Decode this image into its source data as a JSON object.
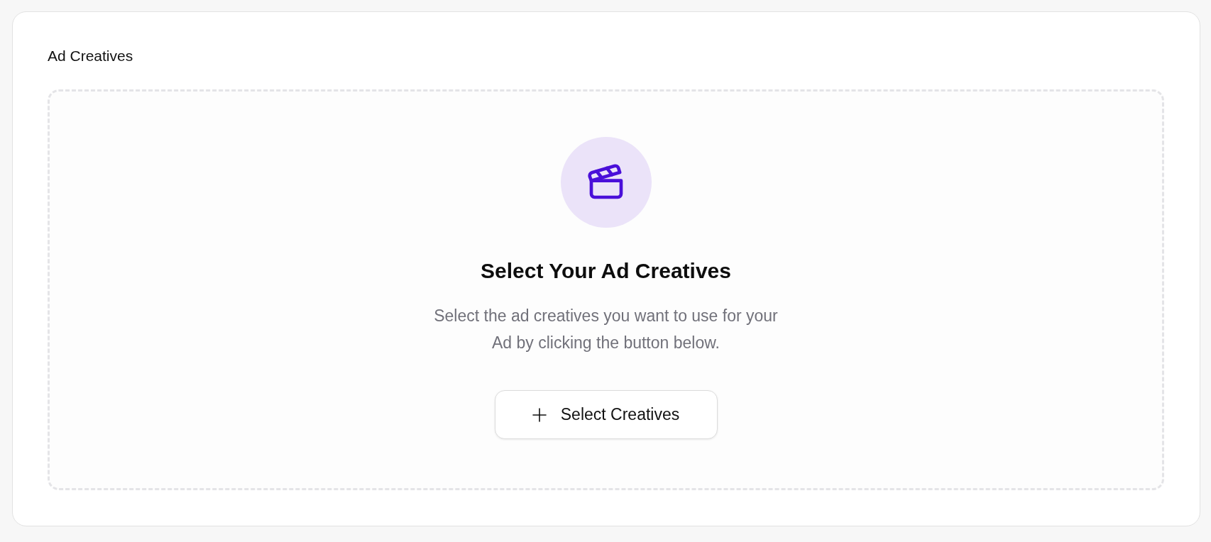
{
  "section": {
    "title": "Ad Creatives"
  },
  "empty_state": {
    "heading": "Select Your Ad Creatives",
    "description": "Select the ad creatives you want to use for your Ad by clicking the button below.",
    "button": {
      "label": "Select Creatives"
    }
  }
}
